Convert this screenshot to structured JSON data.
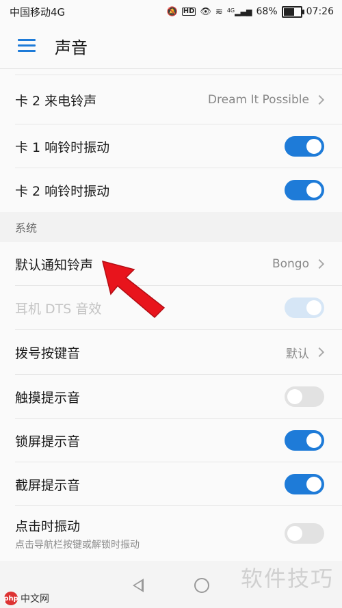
{
  "status_bar": {
    "carrier": "中国移动4G",
    "hd_badge": "HD",
    "network": "4G",
    "battery_percent": "68%",
    "battery_level": 0.68,
    "time": "07:26"
  },
  "app_bar": {
    "title": "声音"
  },
  "rows_top": [
    {
      "label": "卡 2 来电铃声",
      "value": "Dream It Possible"
    },
    {
      "label": "卡 1 响铃时振动",
      "toggle": "on"
    },
    {
      "label": "卡 2 响铃时振动",
      "toggle": "on"
    }
  ],
  "section": {
    "title": "系统"
  },
  "rows_system": [
    {
      "label": "默认通知铃声",
      "value": "Bongo"
    },
    {
      "label": "耳机 DTS 音效",
      "toggle": "disabled-on"
    },
    {
      "label": "拨号按键音",
      "value": "默认"
    },
    {
      "label": "触摸提示音",
      "toggle": "off"
    },
    {
      "label": "锁屏提示音",
      "toggle": "on"
    },
    {
      "label": "截屏提示音",
      "toggle": "on"
    },
    {
      "label": "点击时振动",
      "sub": "点击导航栏按键或解锁时振动",
      "toggle": "off"
    }
  ],
  "colors": {
    "accent": "#1e7bd8",
    "arrow": "#e8141c"
  },
  "watermark": "软件技巧",
  "logo": {
    "badge": "php",
    "text": "中文网"
  }
}
